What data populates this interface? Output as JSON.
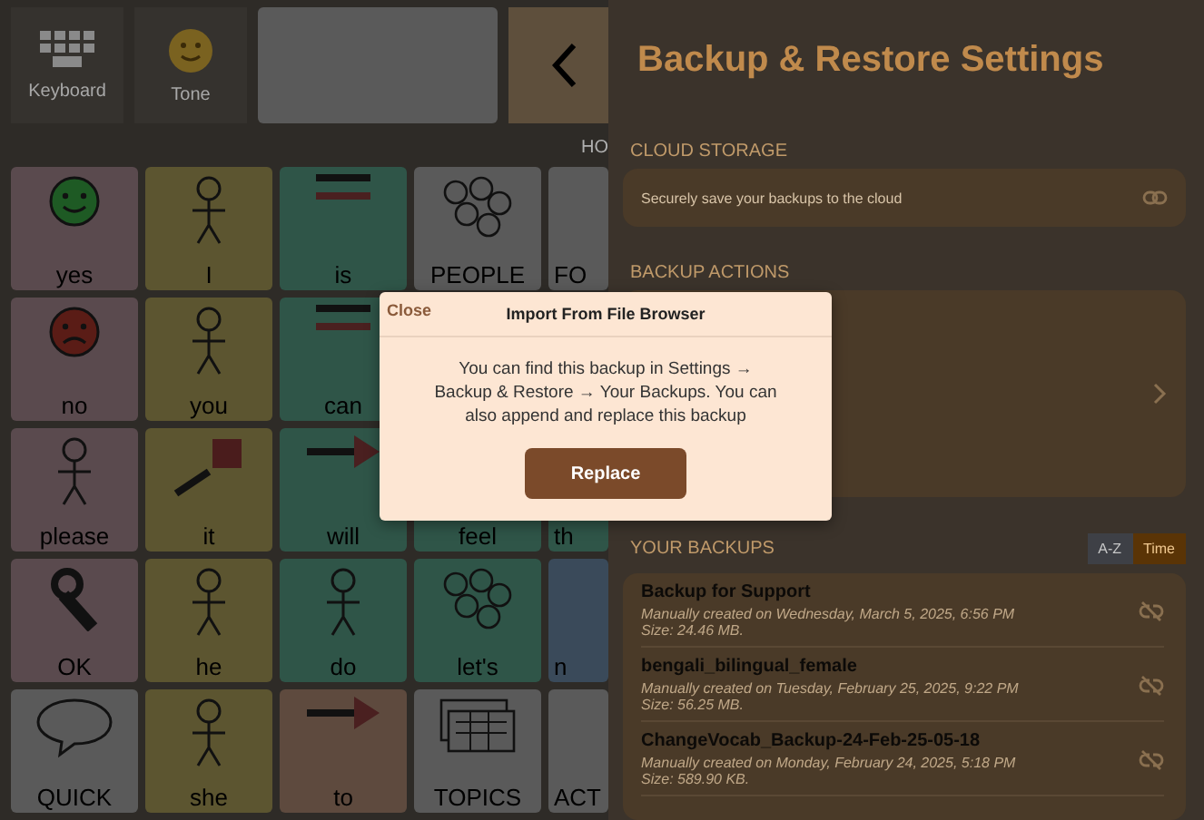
{
  "toolbar": {
    "buttons": [
      {
        "label": "Keyboard",
        "kind": "keyboard"
      },
      {
        "label": "Tone",
        "kind": "tone"
      }
    ],
    "section_label": "HO"
  },
  "grid": {
    "rows": [
      [
        {
          "label": "yes",
          "kind": "smile",
          "color": "#5a4a4e"
        },
        {
          "label": "I",
          "kind": "person",
          "color": "#5c5530"
        },
        {
          "label": "is",
          "kind": "lines",
          "color": "#2f5548"
        },
        {
          "label": "PEOPLE",
          "kind": "people",
          "color": "#5a5a5a"
        },
        {
          "label": "FO",
          "kind": "none",
          "color": "#5a5a5a"
        }
      ],
      [
        {
          "label": "no",
          "kind": "frown",
          "color": "#5a4a4e"
        },
        {
          "label": "you",
          "kind": "person",
          "color": "#5c5530"
        },
        {
          "label": "can",
          "kind": "lines",
          "color": "#2f5548"
        }
      ],
      [
        {
          "label": "please",
          "kind": "person",
          "color": "#5a4a4e"
        },
        {
          "label": "it",
          "kind": "point",
          "color": "#5c5530"
        },
        {
          "label": "will",
          "kind": "arrow",
          "color": "#2f5548"
        },
        {
          "label": "feel",
          "kind": "none",
          "color": "#2f5548"
        },
        {
          "label": "th",
          "kind": "none",
          "color": "#2f5548"
        }
      ],
      [
        {
          "label": "OK",
          "kind": "hand",
          "color": "#5a4a4e"
        },
        {
          "label": "he",
          "kind": "person",
          "color": "#5c5530"
        },
        {
          "label": "do",
          "kind": "person",
          "color": "#2f5548"
        },
        {
          "label": "let's",
          "kind": "people",
          "color": "#2f5548"
        },
        {
          "label": "n",
          "kind": "none",
          "color": "#3a4a5a"
        }
      ],
      [
        {
          "label": "QUICK",
          "kind": "bubble",
          "color": "#5a5a5a"
        },
        {
          "label": "she",
          "kind": "person",
          "color": "#5c5530"
        },
        {
          "label": "to",
          "kind": "arrow",
          "color": "#5e4a3e"
        },
        {
          "label": "TOPICS",
          "kind": "grid",
          "color": "#5a5a5a"
        },
        {
          "label": "ACT",
          "kind": "none",
          "color": "#5a5a5a"
        }
      ]
    ]
  },
  "settings": {
    "title": "Backup & Restore Settings",
    "cloud_storage": {
      "heading": "CLOUD STORAGE",
      "item": "Securely save your backups to the cloud"
    },
    "backup_actions": {
      "heading": "BACKUP ACTIONS"
    },
    "your_backups": {
      "heading": "YOUR BACKUPS",
      "sort": [
        {
          "label": "A-Z",
          "selected": false
        },
        {
          "label": "Time",
          "selected": true
        }
      ],
      "items": [
        {
          "name": "Backup for Support",
          "created": "Manually created on Wednesday, March 5, 2025, 6:56 PM",
          "size": "Size: 24.46 MB."
        },
        {
          "name": "bengali_bilingual_female",
          "created": "Manually created on Tuesday, February 25, 2025, 9:22 PM",
          "size": "Size: 56.25 MB."
        },
        {
          "name": "ChangeVocab_Backup-24-Feb-25-05-18",
          "created": "Manually created on Monday, February 24, 2025, 5:18 PM",
          "size": "Size: 589.90 KB."
        }
      ]
    }
  },
  "dialog": {
    "close": "Close",
    "title": "Import From File Browser",
    "message": "You can find this backup in Settings → Backup & Restore → Your Backups. You can also append and replace this backup",
    "button": "Replace"
  }
}
